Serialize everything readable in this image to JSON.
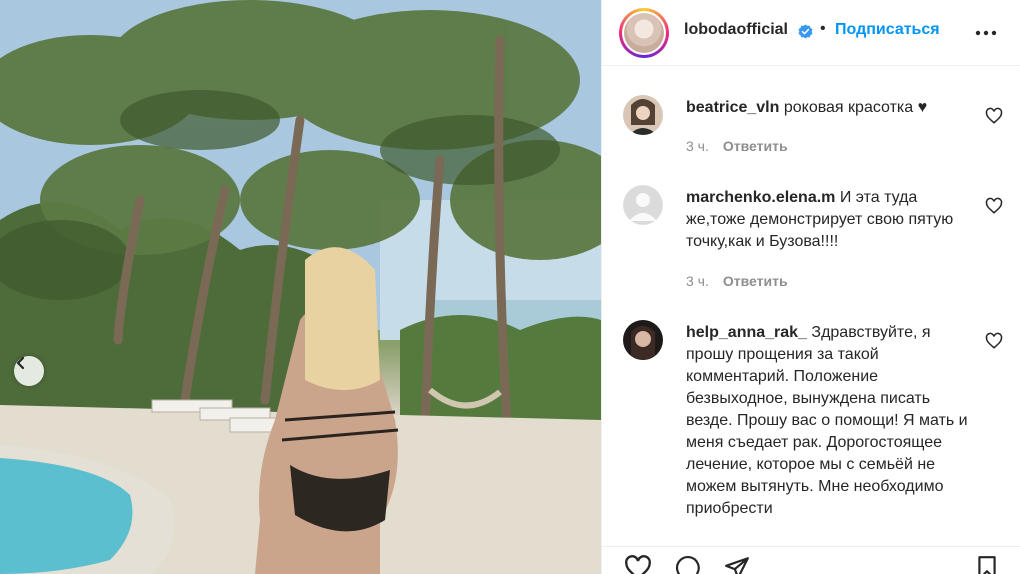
{
  "post": {
    "username": "lobodaofficial",
    "separator": "•",
    "follow_label": "Подписаться",
    "photo_alt": ""
  },
  "comments": [
    {
      "username": "beatrice_vln",
      "text": " роковая красотка ",
      "emoji": "♥",
      "time": "3 ч.",
      "reply": "Ответить"
    },
    {
      "username": "marchenko.elena.m",
      "text": " И эта туда же,тоже демонстрирует свою пятую точку,как и Бузова!!!!",
      "time": "3 ч.",
      "reply": "Ответить"
    },
    {
      "username": "help_anna_rak_",
      "text": " Здравствуйте, я прошу прощения за такой комментарий. Положение безвыходное, вынуждена писать везде. Прошу вас о помощи! Я мать и меня съедает рак. Дорогостоящее лечение, которое мы с семьёй не можем вытянуть. Мне необходимо приобрести",
      "time": "",
      "reply": ""
    }
  ],
  "icons": {
    "verified": "verified-badge-icon",
    "more": "more-options-icon",
    "like": "heart-icon",
    "comment": "comment-icon",
    "share": "share-icon",
    "save": "bookmark-icon",
    "prev": "chevron-left-icon"
  },
  "colors": {
    "accent": "#0095f6",
    "text": "#262626",
    "muted": "#8e8e8e",
    "border": "#efefef"
  }
}
